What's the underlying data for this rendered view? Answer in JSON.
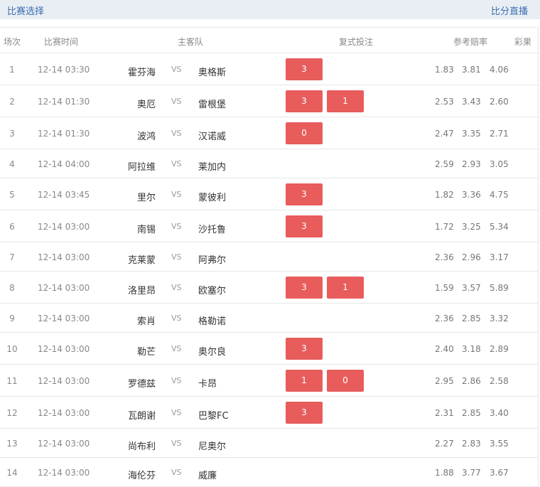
{
  "topbar": {
    "left_label": "比赛选择",
    "right_label": "比分直播"
  },
  "header": {
    "col_no": "场次",
    "col_time": "比赛时间",
    "col_teams": "主客队",
    "col_bet": "复式投注",
    "col_odds": "参考赔率",
    "col_lottery": "彩果"
  },
  "vs_label": "VS",
  "matches": [
    {
      "no": "1",
      "time": "12-14 03:30",
      "home": "霍芬海",
      "away": "奥格斯",
      "picks": [
        "3"
      ],
      "odds": [
        "1.83",
        "3.81",
        "4.06"
      ]
    },
    {
      "no": "2",
      "time": "12-14 01:30",
      "home": "奥厄",
      "away": "雷根堡",
      "picks": [
        "3",
        "1"
      ],
      "odds": [
        "2.53",
        "3.43",
        "2.60"
      ]
    },
    {
      "no": "3",
      "time": "12-14 01:30",
      "home": "波鸿",
      "away": "汉诺威",
      "picks": [
        "0"
      ],
      "odds": [
        "2.47",
        "3.35",
        "2.71"
      ]
    },
    {
      "no": "4",
      "time": "12-14 04:00",
      "home": "阿拉维",
      "away": "莱加内",
      "picks": [],
      "odds": [
        "2.59",
        "2.93",
        "3.05"
      ]
    },
    {
      "no": "5",
      "time": "12-14 03:45",
      "home": "里尔",
      "away": "蒙彼利",
      "picks": [
        "3"
      ],
      "odds": [
        "1.82",
        "3.36",
        "4.75"
      ]
    },
    {
      "no": "6",
      "time": "12-14 03:00",
      "home": "南锡",
      "away": "沙托鲁",
      "picks": [
        "3"
      ],
      "odds": [
        "1.72",
        "3.25",
        "5.34"
      ]
    },
    {
      "no": "7",
      "time": "12-14 03:00",
      "home": "克莱蒙",
      "away": "阿弗尔",
      "picks": [],
      "odds": [
        "2.36",
        "2.96",
        "3.17"
      ]
    },
    {
      "no": "8",
      "time": "12-14 03:00",
      "home": "洛里昂",
      "away": "欧塞尔",
      "picks": [
        "3",
        "1"
      ],
      "odds": [
        "1.59",
        "3.57",
        "5.89"
      ]
    },
    {
      "no": "9",
      "time": "12-14 03:00",
      "home": "索肖",
      "away": "格勒诺",
      "picks": [],
      "odds": [
        "2.36",
        "2.85",
        "3.32"
      ]
    },
    {
      "no": "10",
      "time": "12-14 03:00",
      "home": "勒芒",
      "away": "奥尔良",
      "picks": [
        "3"
      ],
      "odds": [
        "2.40",
        "3.18",
        "2.89"
      ]
    },
    {
      "no": "11",
      "time": "12-14 03:00",
      "home": "罗德兹",
      "away": "卡昂",
      "picks": [
        "1",
        "0"
      ],
      "odds": [
        "2.95",
        "2.86",
        "2.58"
      ]
    },
    {
      "no": "12",
      "time": "12-14 03:00",
      "home": "瓦朗谢",
      "away": "巴黎FC",
      "picks": [
        "3"
      ],
      "odds": [
        "2.31",
        "2.85",
        "3.40"
      ]
    },
    {
      "no": "13",
      "time": "12-14 03:00",
      "home": "尚布利",
      "away": "尼奥尔",
      "picks": [],
      "odds": [
        "2.27",
        "2.83",
        "3.55"
      ]
    },
    {
      "no": "14",
      "time": "12-14 03:00",
      "home": "海伦芬",
      "away": "威廉",
      "picks": [],
      "odds": [
        "1.88",
        "3.77",
        "3.67"
      ]
    }
  ]
}
